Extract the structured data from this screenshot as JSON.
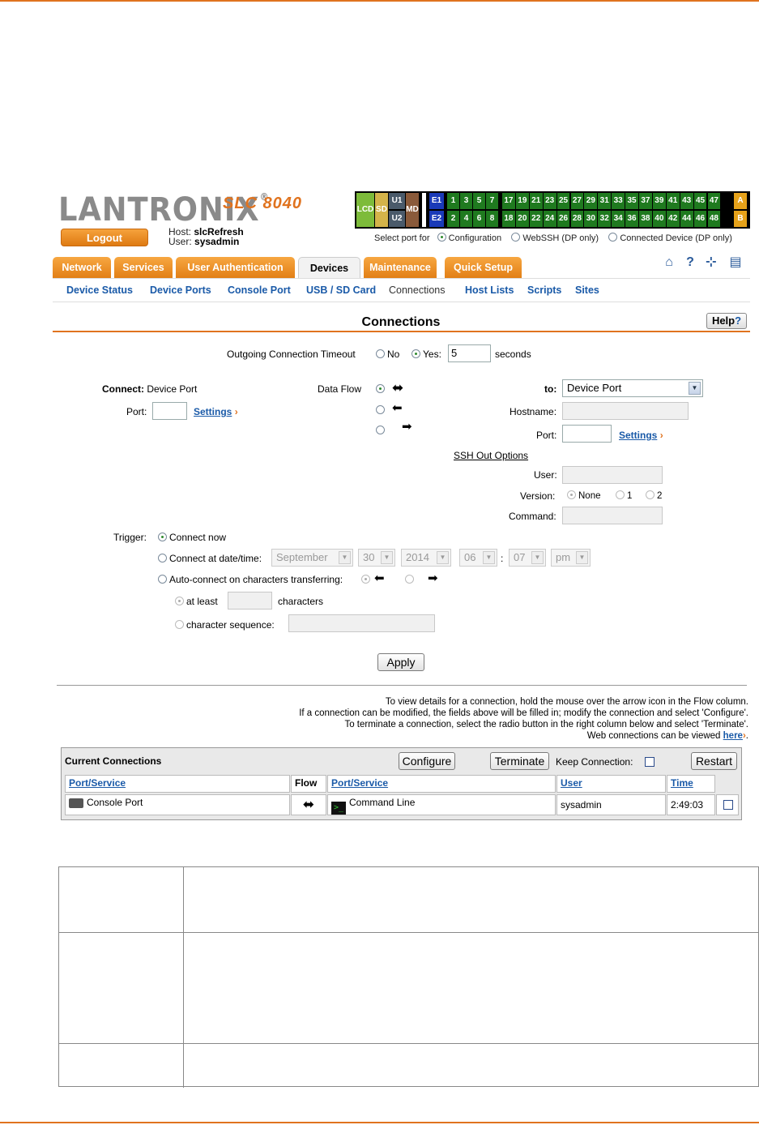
{
  "header": {
    "brand": "LANTRONIX",
    "model": "SLC 8040",
    "logout_label": "Logout",
    "host_label": "Host:",
    "host_value": "slcRefresh",
    "user_label": "User:",
    "user_value": "sysadmin"
  },
  "port_panel": {
    "lcd": "LCD",
    "sd": "SD",
    "u1": "U1",
    "u2": "U2",
    "md": "MD",
    "e1": "E1",
    "e2": "E2",
    "top_ports": [
      "1",
      "3",
      "5",
      "7",
      "17",
      "19",
      "21",
      "23",
      "25",
      "27",
      "29",
      "31",
      "33",
      "35",
      "37",
      "39",
      "41",
      "43",
      "45",
      "47"
    ],
    "bottom_ports": [
      "2",
      "4",
      "6",
      "8",
      "18",
      "20",
      "22",
      "24",
      "26",
      "28",
      "30",
      "32",
      "34",
      "36",
      "38",
      "40",
      "42",
      "44",
      "46",
      "48"
    ],
    "a": "A",
    "b": "B",
    "select_label": "Select port for",
    "opt_config": "Configuration",
    "opt_webssh": "WebSSH (DP only)",
    "opt_connected": "Connected Device (DP only)"
  },
  "tabs": [
    "Network",
    "Services",
    "User Authentication",
    "Devices",
    "Maintenance",
    "Quick Setup"
  ],
  "subnav": [
    "Device Status",
    "Device Ports",
    "Console Port",
    "USB / SD Card",
    "Connections",
    "Host Lists",
    "Scripts",
    "Sites"
  ],
  "page": {
    "title": "Connections",
    "help_label": "Help",
    "help_q": "?"
  },
  "form": {
    "timeout_label": "Outgoing Connection Timeout",
    "no_label": "No",
    "yes_label": "Yes:",
    "timeout_value": "5",
    "seconds_label": "seconds",
    "connect_label": "Connect:",
    "connect_value": "Device Port",
    "port_label": "Port:",
    "settings_label": "Settings",
    "dataflow_label": "Data Flow",
    "to_label": "to:",
    "to_value": "Device Port",
    "hostname_label": "Hostname:",
    "port2_label": "Port:",
    "settings2_label": "Settings",
    "ssh_options_label": "SSH Out Options",
    "user_label": "User:",
    "version_label": "Version:",
    "version_none": "None",
    "version_1": "1",
    "version_2": "2",
    "command_label": "Command:",
    "trigger_label": "Trigger:",
    "connect_now": "Connect now",
    "connect_at": "Connect at date/time:",
    "month": "September",
    "day": "30",
    "year": "2014",
    "hour": "06",
    "time_sep": ":",
    "minute": "07",
    "ampm": "pm",
    "auto_connect": "Auto-connect on characters transferring:",
    "at_least": "at least",
    "characters": "characters",
    "char_sequence": "character sequence:",
    "apply_label": "Apply"
  },
  "notes": [
    "To view details for a connection, hold the mouse over the arrow icon in the Flow column.",
    "If a connection can be modified, the fields above will be filled in; modify the connection and select 'Configure'.",
    "To terminate a connection, select the radio button in the right column below and select 'Terminate'."
  ],
  "web_note_prefix": "Web connections can be viewed",
  "web_note_link": "here",
  "current": {
    "title": "Current Connections",
    "configure_label": "Configure",
    "terminate_label": "Terminate",
    "keep_label": "Keep Connection:",
    "restart_label": "Restart",
    "columns": [
      "Port/Service",
      "Flow",
      "Port/Service",
      "User",
      "Time"
    ],
    "row": {
      "port": "Console Port",
      "service": "Command Line",
      "user": "sysadmin",
      "time": "2:49:03"
    }
  },
  "colors": {
    "accent": "#e0731f",
    "link": "#1a5aa8",
    "port_green": "#1f7a1f"
  }
}
